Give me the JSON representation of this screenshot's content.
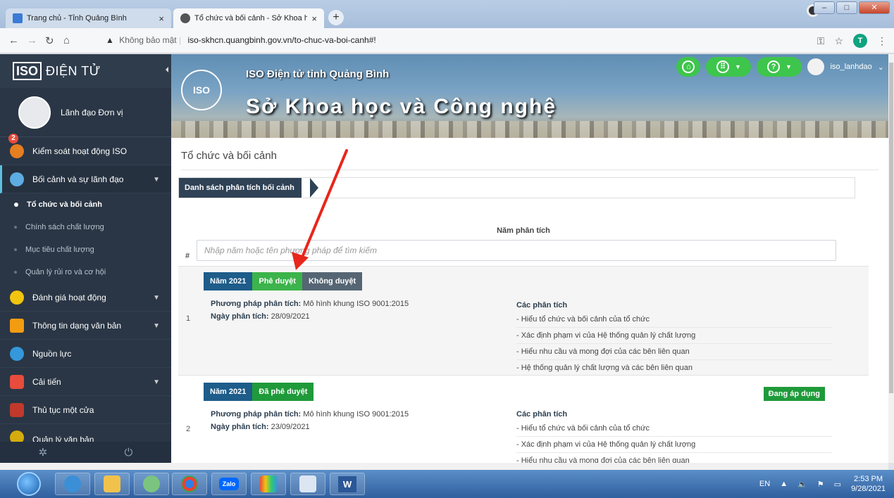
{
  "browser": {
    "tabs": [
      {
        "label": "Trang chủ - Tỉnh Quảng Bình",
        "close": "×"
      },
      {
        "label": "Tổ chức và bối cảnh - Sở Khoa h",
        "close": "×"
      }
    ],
    "new_tab": "+",
    "security_label": "Không bảo mật",
    "url": "iso-skhcn.quangbinh.gov.vn/to-chuc-va-boi-canh#!",
    "profile_initial": "T"
  },
  "sidebar": {
    "logo_iso": "ISO",
    "logo_text": "ĐIỆN TỬ",
    "user_role": "Lãnh đạo Đơn vị",
    "items": [
      {
        "label": "Kiểm soát hoạt động ISO",
        "badge": "2",
        "color": "#e67e22"
      },
      {
        "label": "Bối cảnh và sự lãnh đạo",
        "color": "#5dade2"
      },
      {
        "label": "Đánh giá hoạt động",
        "color": "#f1c40f"
      },
      {
        "label": "Thông tin dạng văn bản",
        "color": "#f39c12"
      },
      {
        "label": "Nguồn lực",
        "color": "#3498db"
      },
      {
        "label": "Cải tiến",
        "color": "#e74c3c"
      },
      {
        "label": "Thủ tục một cửa",
        "color": "#c0392b"
      },
      {
        "label": "Quản lý văn bản",
        "color": "#d4ac0d"
      }
    ],
    "subitems": [
      "Tổ chức và bối cảnh",
      "Chính sách chất lượng",
      "Mục tiêu chất lượng",
      "Quản lý rủi ro và cơ hội"
    ]
  },
  "banner": {
    "seal": "ISO",
    "subtitle": "ISO Điện tử tỉnh Quảng Bình",
    "title": "Sở Khoa học và Công nghệ",
    "username": "iso_lanhdao"
  },
  "main": {
    "page_title": "Tổ chức và bối cảnh",
    "breadcrumb": "Danh sách phân tích bối cảnh",
    "column_header": "Năm phân tích",
    "hash": "#",
    "search_placeholder": "Nhập năm hoặc tên phương pháp để tìm kiếm",
    "method_label": "Phương pháp phân tích:",
    "date_label": "Ngày phân tích:",
    "analysis_heading": "Các phân tích",
    "rows": [
      {
        "num": "1",
        "year_tag": "Năm 2021",
        "approve_btn": "Phê duyệt",
        "reject_btn": "Không duyệt",
        "method": "Mô hình khung ISO 9001:2015",
        "date": "28/09/2021",
        "analyses": [
          "- Hiểu tổ chức và bối cảnh của tổ chức",
          "- Xác định phạm vi của Hệ thống quản lý chất lượng",
          "- Hiểu nhu cầu và mong đợi của các bên liên quan",
          "- Hệ thống quản lý chất lượng và các bên liên quan"
        ]
      },
      {
        "num": "2",
        "year_tag": "Năm 2021",
        "approved_tag": "Đã phê duyệt",
        "status": "Đang áp dụng",
        "method": "Mô hình khung ISO 9001:2015",
        "date": "23/09/2021",
        "analyses": [
          "- Hiểu tổ chức và bối cảnh của tổ chức",
          "- Xác định phạm vi của Hệ thống quản lý chất lượng",
          "- Hiểu nhu cầu và mong đợi của các bên liên quan"
        ]
      }
    ]
  },
  "taskbar": {
    "zalo": "Zalo",
    "word": "W",
    "lang": "EN",
    "time": "2:53 PM",
    "date": "9/28/2021"
  }
}
